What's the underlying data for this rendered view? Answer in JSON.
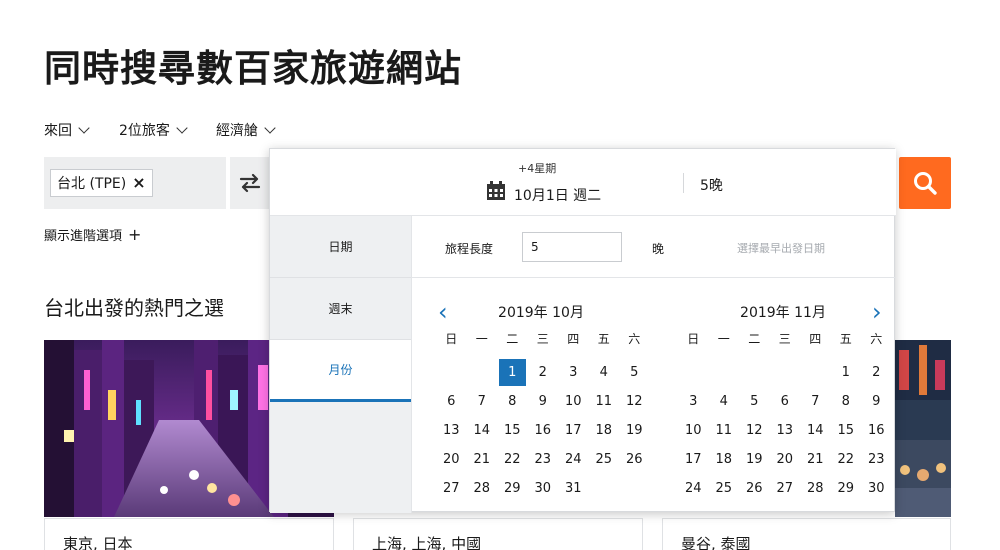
{
  "hero": {
    "title": "同時搜尋數百家旅遊網站"
  },
  "options": {
    "trip_type": "來回",
    "travelers": "2位旅客",
    "cabin": "經濟艙"
  },
  "search": {
    "origin_chip": "台北 (TPE)",
    "origin_remove": "×",
    "advanced_label": "顯示進階選項",
    "advanced_plus": "+"
  },
  "section": {
    "title": "台北出發的熱門之選"
  },
  "cards": [
    {
      "caption": "東京, 日本"
    },
    {
      "caption": "上海, 上海, 中國"
    },
    {
      "caption": "曼谷, 泰國"
    }
  ],
  "popup": {
    "flex_label": "+4星期",
    "date_label": "10月1日 週二",
    "nights_label": "5晚",
    "tabs": [
      "日期",
      "週末",
      "月份"
    ],
    "active_tab": "月份",
    "trip_length_label": "旅程長度",
    "trip_length_value": "5",
    "trip_length_unit": "晚",
    "hint": "選擇最早出發日期",
    "prev_arrow": "‹",
    "next_arrow": "›",
    "weekdays": [
      "日",
      "一",
      "二",
      "三",
      "四",
      "五",
      "六"
    ],
    "months": [
      {
        "title": "2019年 10月",
        "offset": 2,
        "days": 31,
        "selected": 1
      },
      {
        "title": "2019年 11月",
        "offset": 5,
        "days": 30,
        "selected": null
      }
    ]
  },
  "colors": {
    "accent": "#1a73b8",
    "search_button": "#ff6a1f"
  }
}
